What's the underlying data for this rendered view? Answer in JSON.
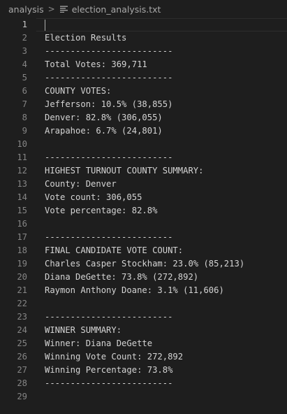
{
  "breadcrumb": {
    "folder": "analysis",
    "separator": ">",
    "file_icon": "lines-file-icon",
    "file": "election_analysis.txt"
  },
  "editor": {
    "lines": [
      {
        "number": "1",
        "text": ""
      },
      {
        "number": "2",
        "text": "Election Results"
      },
      {
        "number": "3",
        "text": "-------------------------"
      },
      {
        "number": "4",
        "text": "Total Votes: 369,711"
      },
      {
        "number": "5",
        "text": "-------------------------"
      },
      {
        "number": "6",
        "text": "COUNTY VOTES:"
      },
      {
        "number": "7",
        "text": "Jefferson: 10.5% (38,855)"
      },
      {
        "number": "8",
        "text": "Denver: 82.8% (306,055)"
      },
      {
        "number": "9",
        "text": "Arapahoe: 6.7% (24,801)"
      },
      {
        "number": "10",
        "text": ""
      },
      {
        "number": "11",
        "text": "-------------------------"
      },
      {
        "number": "12",
        "text": "HIGHEST TURNOUT COUNTY SUMMARY:"
      },
      {
        "number": "13",
        "text": "County: Denver"
      },
      {
        "number": "14",
        "text": "Vote count: 306,055"
      },
      {
        "number": "15",
        "text": "Vote percentage: 82.8%"
      },
      {
        "number": "16",
        "text": ""
      },
      {
        "number": "17",
        "text": "-------------------------"
      },
      {
        "number": "18",
        "text": "FINAL CANDIDATE VOTE COUNT:"
      },
      {
        "number": "19",
        "text": "Charles Casper Stockham: 23.0% (85,213)"
      },
      {
        "number": "20",
        "text": "Diana DeGette: 73.8% (272,892)"
      },
      {
        "number": "21",
        "text": "Raymon Anthony Doane: 3.1% (11,606)"
      },
      {
        "number": "22",
        "text": ""
      },
      {
        "number": "23",
        "text": "-------------------------"
      },
      {
        "number": "24",
        "text": "WINNER SUMMARY:"
      },
      {
        "number": "25",
        "text": "Winner: Diana DeGette"
      },
      {
        "number": "26",
        "text": "Winning Vote Count: 272,892"
      },
      {
        "number": "27",
        "text": "Winning Percentage: 73.8%"
      },
      {
        "number": "28",
        "text": "-------------------------"
      },
      {
        "number": "29",
        "text": ""
      }
    ]
  }
}
